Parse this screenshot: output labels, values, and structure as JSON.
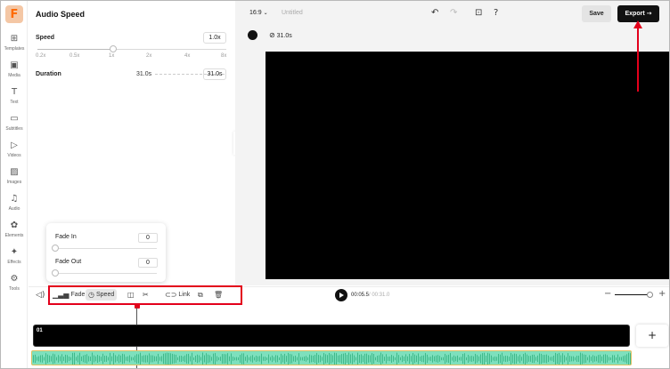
{
  "app": {
    "logo_letter": "F"
  },
  "rail": [
    {
      "label": "Templates",
      "icon": "templates-icon",
      "glyph": "⊞"
    },
    {
      "label": "Media",
      "icon": "media-icon",
      "glyph": "▣"
    },
    {
      "label": "Text",
      "icon": "text-icon",
      "glyph": "T"
    },
    {
      "label": "Subtitles",
      "icon": "subtitles-icon",
      "glyph": "▭"
    },
    {
      "label": "Videos",
      "icon": "videos-icon",
      "glyph": "▷"
    },
    {
      "label": "Images",
      "icon": "images-icon",
      "glyph": "▨"
    },
    {
      "label": "Audio",
      "icon": "audio-icon",
      "glyph": "♫"
    },
    {
      "label": "Elements",
      "icon": "elements-icon",
      "glyph": "✿"
    },
    {
      "label": "Effects",
      "icon": "effects-icon",
      "glyph": "✦"
    },
    {
      "label": "Tools",
      "icon": "tools-icon",
      "glyph": "⚙"
    }
  ],
  "panel": {
    "title": "Audio Speed",
    "speed_label": "Speed",
    "speed_value": "1.0x",
    "speed_level": 0.4,
    "ticks": [
      "0.2x",
      "0.5x",
      "1x",
      "2x",
      "4x",
      "8x"
    ],
    "duration_label": "Duration",
    "duration_from": "31.0s",
    "duration_to": "31.0s"
  },
  "fade": {
    "fade_in_label": "Fade In",
    "fade_in_value": "0",
    "fade_out_label": "Fade Out",
    "fade_out_value": "0"
  },
  "topbar": {
    "ratio": "16:9",
    "doc_title": "Untitled",
    "save_label": "Save",
    "export_label": "Export"
  },
  "canvas": {
    "duration_badge": "31.0s",
    "background_color": "#000000"
  },
  "toolbar": {
    "fade_label": "Fade",
    "speed_label": "Speed",
    "link_label": "Link",
    "time_current": "00:05.5",
    "time_total": "/ 00:31.0"
  },
  "timeline": {
    "clip_label": "01",
    "add_label": "+"
  },
  "colors": {
    "accent": "#ff6a00",
    "annotation": "#e3001b",
    "audio_wave": "#7ee0bd"
  }
}
